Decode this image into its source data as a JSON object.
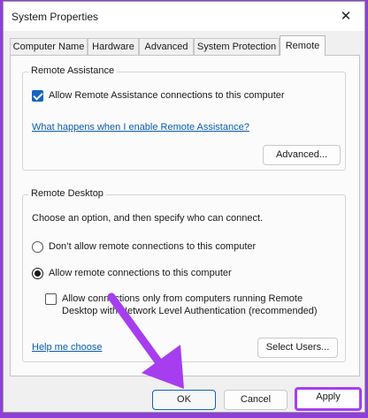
{
  "window": {
    "title": "System Properties",
    "close_glyph": "✕"
  },
  "tabs": [
    {
      "label": "Computer Name",
      "active": false
    },
    {
      "label": "Hardware",
      "active": false
    },
    {
      "label": "Advanced",
      "active": false
    },
    {
      "label": "System Protection",
      "active": false
    },
    {
      "label": "Remote",
      "active": true
    }
  ],
  "remote_assistance": {
    "legend": "Remote Assistance",
    "allow_checkbox": {
      "label": "Allow Remote Assistance connections to this computer",
      "checked": true
    },
    "help_link": "What happens when I enable Remote Assistance?",
    "advanced_button": "Advanced..."
  },
  "remote_desktop": {
    "legend": "Remote Desktop",
    "instructions": "Choose an option, and then specify who can connect.",
    "option_dont_allow": {
      "label": "Don’t allow remote connections to this computer",
      "selected": false
    },
    "option_allow": {
      "label": "Allow remote connections to this computer",
      "selected": true
    },
    "nla_checkbox": {
      "line1": "Allow connections only from computers running Remote",
      "line2": "Desktop with Network Level Authentication (recommended)",
      "checked": false
    },
    "help_link": "Help me choose",
    "select_users_button": "Select Users..."
  },
  "footer": {
    "ok_button": "OK",
    "cancel_button": "Cancel",
    "apply_button": "Apply"
  },
  "colors": {
    "accent": "#a63ef0",
    "arrow": "#a63ef0",
    "link": "#0b5cad",
    "checkbox": "#1565c0",
    "background": "#8e3fd8"
  },
  "icons": {
    "close": "close-icon",
    "annotation": "pointer-arrow-icon"
  }
}
